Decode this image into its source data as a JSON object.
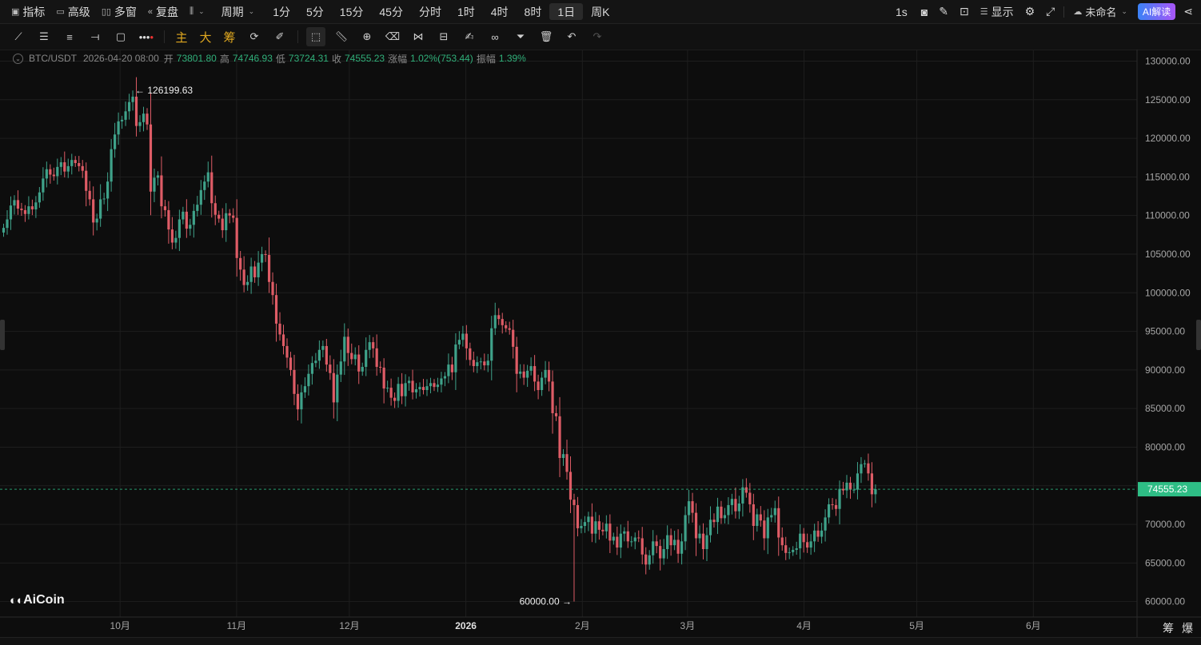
{
  "topbar": {
    "indicators_label": "指标",
    "advanced_label": "高级",
    "multi_window_label": "多窗",
    "replay_label": "复盘",
    "period_label": "周期",
    "periods": [
      "1分",
      "5分",
      "15分",
      "45分",
      "分时",
      "1时",
      "4时",
      "8时",
      "1日",
      "周K"
    ],
    "active_period": "1日",
    "interval_label": "1s",
    "display_label": "显示",
    "layout_name": "未命名",
    "ai_label": "AI解读"
  },
  "drawing_toolbar": {
    "main_label": "主",
    "big_label": "大",
    "chip_label": "筹"
  },
  "ohlc": {
    "symbol": "BTC/USDT",
    "datetime": "2026-04-20 08:00",
    "open_label": "开",
    "open": "73801.80",
    "high_label": "高",
    "high": "74746.93",
    "low_label": "低",
    "low": "73724.31",
    "close_label": "收",
    "close": "74555.23",
    "change_label": "涨幅",
    "change": "1.02%(753.44)",
    "amplitude_label": "振幅",
    "amplitude": "1.39%"
  },
  "chart_data": {
    "type": "candlestick",
    "symbol": "BTC/USDT",
    "interval": "1日",
    "y_ticks": [
      130000,
      125000,
      120000,
      115000,
      110000,
      105000,
      100000,
      95000,
      90000,
      85000,
      80000,
      75000,
      70000,
      65000,
      60000
    ],
    "y_tick_labels": [
      "130000.00",
      "125000.00",
      "120000.00",
      "115000.00",
      "110000.00",
      "105000.00",
      "100000.00",
      "95000.00",
      "90000.00",
      "85000.00",
      "80000.00",
      "75000.00",
      "70000.00",
      "65000.00",
      "60000.00"
    ],
    "ylim": [
      58000,
      131500
    ],
    "x_ticks": [
      {
        "label": "10月",
        "date": "2025-10-01"
      },
      {
        "label": "11月",
        "date": "2025-11-01"
      },
      {
        "label": "12月",
        "date": "2025-12-01"
      },
      {
        "label": "2026",
        "date": "2026-01-01"
      },
      {
        "label": "2月",
        "date": "2026-02-01"
      },
      {
        "label": "3月",
        "date": "2026-03-01"
      },
      {
        "label": "4月",
        "date": "2026-04-01"
      },
      {
        "label": "5月",
        "date": "2026-05-01"
      },
      {
        "label": "6月",
        "date": "2026-06-01"
      }
    ],
    "first_date": "2025-08-31",
    "last_price": 74555.23,
    "last_price_label": "74555.23",
    "high_marker": {
      "label": "126199.63",
      "value": 126199.63,
      "date": "2025-10-06"
    },
    "low_marker": {
      "label": "60000.00",
      "value": 60000,
      "date": "2026-02-06"
    },
    "closes": [
      108400,
      109500,
      111300,
      112000,
      110900,
      110700,
      110200,
      111200,
      110800,
      111700,
      113000,
      114800,
      116000,
      115300,
      115100,
      116300,
      116900,
      115700,
      116400,
      117200,
      116800,
      116400,
      115800,
      113200,
      112100,
      109100,
      109600,
      112100,
      112200,
      114400,
      118600,
      120500,
      122200,
      122400,
      123500,
      124700,
      125400,
      121600,
      122100,
      123200,
      121800,
      113100,
      114900,
      115200,
      111200,
      110700,
      108200,
      106500,
      107100,
      109500,
      110500,
      108300,
      108800,
      110600,
      111400,
      113300,
      114400,
      115600,
      111600,
      110100,
      109600,
      108100,
      110300,
      110000,
      109700,
      104500,
      103000,
      101000,
      101400,
      103400,
      102000,
      103900,
      105000,
      104900,
      101400,
      99700,
      96000,
      94600,
      93100,
      91600,
      90000,
      86900,
      84900,
      87100,
      87900,
      89500,
      90900,
      91200,
      92600,
      93100,
      90700,
      89600,
      85800,
      89400,
      91100,
      94300,
      92200,
      91400,
      92000,
      89800,
      90400,
      92600,
      93600,
      92800,
      90400,
      90300,
      87600,
      87700,
      86400,
      86000,
      88200,
      86600,
      88300,
      88600,
      87100,
      87500,
      87800,
      87400,
      87900,
      88300,
      87800,
      88100,
      88900,
      89200,
      90700,
      89700,
      93300,
      93900,
      94700,
      92800,
      91300,
      90500,
      91000,
      91100,
      90600,
      91200,
      95400,
      97100,
      96600,
      95800,
      95400,
      95200,
      93000,
      89500,
      89800,
      89000,
      89900,
      90500,
      88500,
      87400,
      89000,
      90000,
      88500,
      84400,
      84000,
      78600,
      79100,
      76800,
      73200,
      72500,
      69500,
      69800,
      70300,
      71000,
      68800,
      70400,
      69300,
      69100,
      70100,
      67900,
      68400,
      67000,
      68800,
      69100,
      67800,
      67800,
      68300,
      68200,
      66100,
      64800,
      66000,
      67800,
      67200,
      65600,
      66800,
      68600,
      67300,
      68000,
      66200,
      67800,
      71200,
      73000,
      71500,
      68200,
      68800,
      66800,
      68600,
      70600,
      70300,
      72300,
      70800,
      71200,
      72500,
      73300,
      71700,
      72700,
      74800,
      74100,
      72600,
      69800,
      71300,
      70500,
      68200,
      70900,
      71200,
      72100,
      68300,
      67300,
      66300,
      66400,
      66700,
      66900,
      68800,
      67700,
      67000,
      67800,
      69200,
      68400,
      69200,
      70900,
      72600,
      72500,
      72000,
      74600,
      74400,
      75400,
      74500,
      74500,
      76600,
      77800,
      77900,
      76600,
      73900,
      74555.23
    ]
  },
  "branding": {
    "logo_text": "AiCoin"
  },
  "bottom_right": {
    "chip_label": "筹",
    "burst_label": "爆"
  },
  "colors": {
    "up": "#3fa28a",
    "down": "#de5c66",
    "grid": "#1e1e1e",
    "axis_text": "#a6a6a6",
    "bg": "#0d0d0d",
    "last_price_bg": "#2ebd85"
  }
}
